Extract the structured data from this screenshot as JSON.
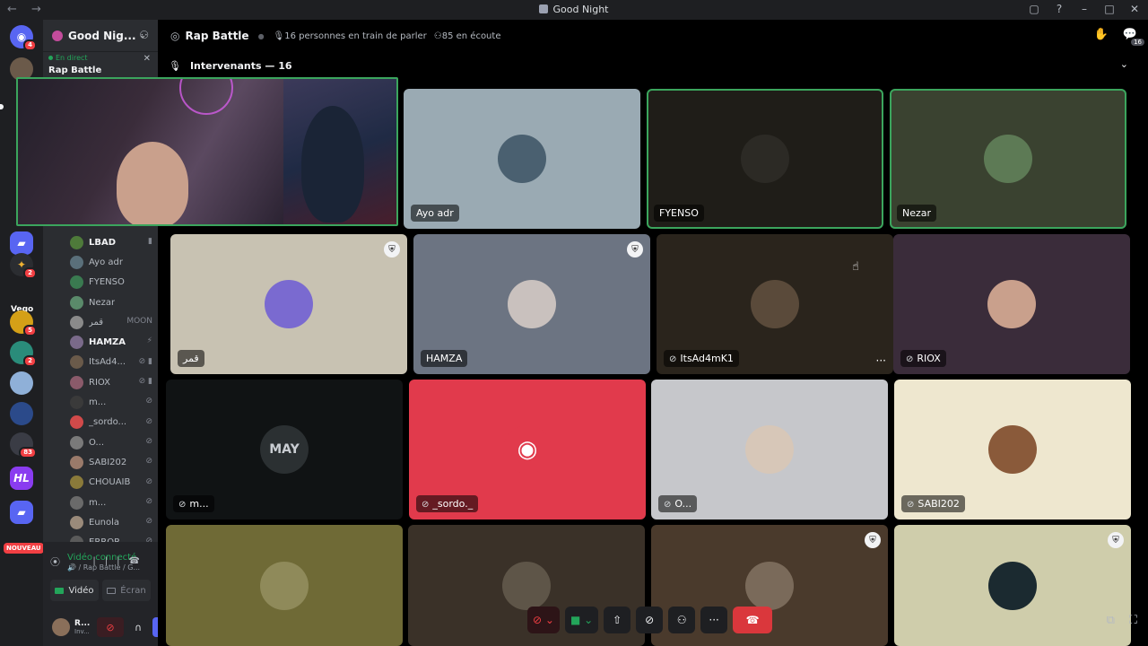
{
  "window": {
    "title": "Good Night",
    "nav": "← →",
    "controls": [
      "▢",
      "?",
      "–",
      "□",
      "✕"
    ]
  },
  "rail": {
    "badges": {
      "home": "4",
      "vego_label": "Vego",
      "s1": "2",
      "s2": "5",
      "s3": "2",
      "s4": "2",
      "s5": "83"
    },
    "new_label": "NOUVEAU"
  },
  "guild": {
    "name": "Good Nig...",
    "chevron": "⌄"
  },
  "live": {
    "status": "En direct",
    "name": "Rap Battle"
  },
  "members": [
    {
      "name": "LBAD",
      "strong": true,
      "status": "▮"
    },
    {
      "name": "Ayo adr",
      "strong": false,
      "status": ""
    },
    {
      "name": "FYENSO",
      "strong": false,
      "status": ""
    },
    {
      "name": "Nezar",
      "strong": false,
      "status": ""
    },
    {
      "name": "قمر",
      "strong": false,
      "status": "MOON"
    },
    {
      "name": "HAMZA",
      "strong": true,
      "status": "⚡"
    },
    {
      "name": "ItsAd4...",
      "strong": false,
      "status": "⊘ ▮"
    },
    {
      "name": "RIOX",
      "strong": false,
      "status": "⊘ ▮"
    },
    {
      "name": "m...",
      "strong": false,
      "status": "⊘"
    },
    {
      "name": "_sordo...",
      "strong": false,
      "status": "⊘"
    },
    {
      "name": "O...",
      "strong": false,
      "status": "⊘"
    },
    {
      "name": "SABI202",
      "strong": false,
      "status": "⊘"
    },
    {
      "name": "CHOUAIB",
      "strong": false,
      "status": "⊘"
    },
    {
      "name": "m...",
      "strong": false,
      "status": "⊘"
    },
    {
      "name": "Eunola",
      "strong": false,
      "status": "⊘"
    },
    {
      "name": "ERROR",
      "strong": false,
      "status": "⊘"
    }
  ],
  "voice": {
    "title": "Vidéo connecté",
    "subtitle": "🔊 / Rap Battle / G...",
    "video_label": "Vidéo",
    "screen_label": "Écran"
  },
  "user": {
    "name": "R...",
    "status": "Inv..."
  },
  "stage": {
    "name": "Rap Battle",
    "speaking": "16 personnes en train de parler",
    "listening": "85 en écoute",
    "speakers_label": "Intervenants — 16",
    "notif_count": "16"
  },
  "tiles": [
    {
      "label": "Ayo adr",
      "bg": "#9aaab3",
      "avatar": "#4a6070",
      "speaking": false,
      "shield": false,
      "muted": false
    },
    {
      "label": "FYENSO",
      "bg": "#1f1d18",
      "avatar": "#2c2a25",
      "speaking": true,
      "shield": false,
      "muted": false
    },
    {
      "label": "Nezar",
      "bg": "#3a4230",
      "avatar": "#5d7a55",
      "speaking": true,
      "shield": false,
      "muted": false
    },
    {
      "label": "قمر",
      "bg": "#c8c2b2",
      "avatar": "#7a6ad0",
      "speaking": false,
      "shield": true,
      "muted": false
    },
    {
      "label": "HAMZA",
      "bg": "#6c7482",
      "avatar": "#c9c1be",
      "speaking": false,
      "shield": true,
      "muted": false
    },
    {
      "label": "ItsAd4mK1",
      "bg": "#2a241c",
      "avatar": "#5a4a3a",
      "speaking": false,
      "shield": false,
      "muted": true
    },
    {
      "label": "RIOX",
      "bg": "#3a2c3a",
      "avatar": "#c9a08c",
      "speaking": false,
      "shield": false,
      "muted": true
    },
    {
      "label": "m...",
      "bg": "#101314",
      "avatar": "#2b3032",
      "speaking": false,
      "shield": false,
      "muted": true
    },
    {
      "label": "_sordo._",
      "bg": "#e13a4c",
      "avatar": "#e13a4c",
      "speaking": false,
      "shield": false,
      "muted": true
    },
    {
      "label": "O...",
      "bg": "#c6c7cb",
      "avatar": "#d7c7b8",
      "speaking": false,
      "shield": false,
      "muted": true
    },
    {
      "label": "SABI202",
      "bg": "#eee7cf",
      "avatar": "#8a5a3a",
      "speaking": false,
      "shield": false,
      "muted": true
    },
    {
      "label": "",
      "bg": "#6f6a36",
      "avatar": "#8f8a5a",
      "speaking": false,
      "shield": false,
      "muted": false
    },
    {
      "label": "",
      "bg": "#3a3128",
      "avatar": "#5e5548",
      "speaking": false,
      "shield": false,
      "muted": false
    },
    {
      "label": "",
      "bg": "#4a3a2c",
      "avatar": "#7a6a5a",
      "speaking": false,
      "shield": true,
      "muted": false
    },
    {
      "label": "",
      "bg": "#cfcdab",
      "avatar": "#1b2a30",
      "speaking": false,
      "shield": true,
      "muted": false
    }
  ],
  "colors": {
    "speaking": "#3ba55d",
    "danger": "#da373c",
    "online": "#23a55a"
  }
}
